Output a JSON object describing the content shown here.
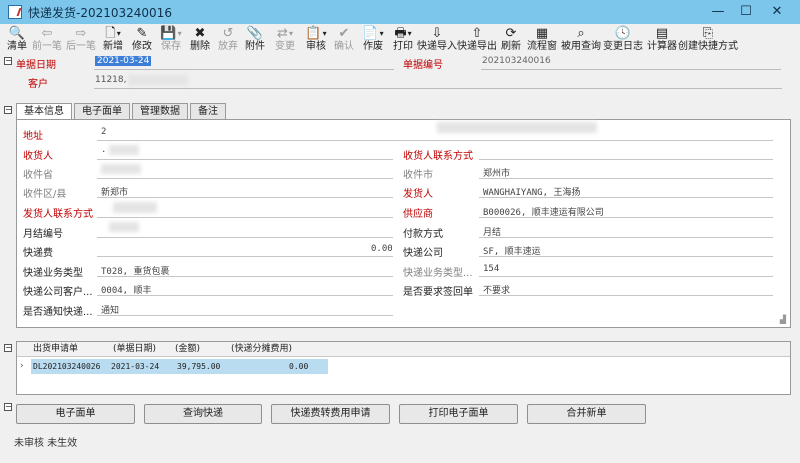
{
  "window": {
    "title": "快递发货-202103240016"
  },
  "toolbar": [
    {
      "label": "清单",
      "icon": "list-search-icon",
      "glyph": "🔍",
      "enabled": true,
      "dd": false
    },
    {
      "label": "前一笔",
      "icon": "arrow-left-icon",
      "glyph": "⇦",
      "enabled": false,
      "dd": false
    },
    {
      "label": "后一笔",
      "icon": "arrow-right-icon",
      "glyph": "⇨",
      "enabled": false,
      "dd": false
    },
    {
      "label": "新增",
      "icon": "new-document-icon",
      "glyph": "🗋",
      "enabled": true,
      "dd": true
    },
    {
      "label": "修改",
      "icon": "edit-icon",
      "glyph": "✎",
      "enabled": true,
      "dd": false
    },
    {
      "label": "保存",
      "icon": "save-icon",
      "glyph": "💾",
      "enabled": false,
      "dd": true
    },
    {
      "label": "删除",
      "icon": "delete-icon",
      "glyph": "✖",
      "enabled": true,
      "dd": false
    },
    {
      "label": "放弃",
      "icon": "discard-icon",
      "glyph": "↺",
      "enabled": false,
      "dd": false
    },
    {
      "label": "附件",
      "icon": "attachment-icon",
      "glyph": "📎",
      "enabled": true,
      "dd": false
    },
    {
      "label": "变更",
      "icon": "change-icon",
      "glyph": "⇄",
      "enabled": false,
      "dd": true
    },
    {
      "label": "审核",
      "icon": "audit-icon",
      "glyph": "📋",
      "enabled": true,
      "dd": true
    },
    {
      "label": "确认",
      "icon": "confirm-icon",
      "glyph": "✔",
      "enabled": false,
      "dd": false
    },
    {
      "label": "作废",
      "icon": "void-icon",
      "glyph": "📄",
      "enabled": true,
      "dd": true
    },
    {
      "label": "打印",
      "icon": "print-icon",
      "glyph": "🖶",
      "enabled": true,
      "dd": true
    },
    {
      "label": "快递导入",
      "icon": "import-icon",
      "glyph": "⇩",
      "enabled": true,
      "dd": false
    },
    {
      "label": "快递导出",
      "icon": "export-icon",
      "glyph": "⇧",
      "enabled": true,
      "dd": false
    },
    {
      "label": "刷新",
      "icon": "refresh-icon",
      "glyph": "⟳",
      "enabled": true,
      "dd": false
    },
    {
      "label": "流程窗",
      "icon": "workflow-icon",
      "glyph": "▦",
      "enabled": true,
      "dd": false
    },
    {
      "label": "被用查询",
      "icon": "reference-query-icon",
      "glyph": "⌕",
      "enabled": true,
      "dd": false
    },
    {
      "label": "变更日志",
      "icon": "change-log-icon",
      "glyph": "🕓",
      "enabled": true,
      "dd": false
    },
    {
      "label": "计算器",
      "icon": "calculator-icon",
      "glyph": "▤",
      "enabled": true,
      "dd": false
    },
    {
      "label": "创建快捷方式",
      "icon": "shortcut-icon",
      "glyph": "⎘",
      "enabled": true,
      "dd": false
    }
  ],
  "header": {
    "date_label": "单据日期",
    "date_value": "2021-03-24",
    "no_label": "单据编号",
    "no_value": "202103240016",
    "customer_label": "客户",
    "customer_value": "11218,"
  },
  "tabs": [
    "基本信息",
    "电子面单",
    "管理数据",
    "备注"
  ],
  "fields": {
    "address_label": "地址",
    "address_value": "2",
    "receiver_label": "收货人",
    "receiver_value": ".",
    "receiver_contact_label": "收货人联系方式",
    "province_label": "收件省",
    "city_label": "收件市",
    "city_value": "郑州市",
    "district_label": "收件区/县",
    "district_value": "新郑市",
    "sender_label": "发货人",
    "sender_value": "WANGHAIYANG, 王海扬",
    "sender_contact_label": "发货人联系方式",
    "supplier_label": "供应商",
    "supplier_value": "B000026, 顺丰速运有限公司",
    "monthly_label": "月结编号",
    "payment_label": "付款方式",
    "payment_value": "月结",
    "fee_label": "快递费",
    "fee_value": "0.00",
    "company_label": "快递公司",
    "company_value": "SF, 顺丰速运",
    "biztype_label": "快递业务类型",
    "biztype_value": "T028, 重货包裹",
    "biztype2_label": "快递业务类型...",
    "biztype2_value": "154",
    "company_cust_label": "快递公司客户...",
    "company_cust_value": "0004, 顺丰",
    "receipt_label": "是否要求签回单",
    "receipt_value": "不要求",
    "notify_label": "是否通知快递...",
    "notify_value": "通知"
  },
  "grid": {
    "headers": [
      "出货申请单",
      "(单据日期)",
      "(金额)",
      "(快递分摊费用)"
    ],
    "rows": [
      [
        "DL202103240026",
        "2021-03-24",
        "39,795.00",
        "0.00"
      ]
    ]
  },
  "buttons": [
    "电子面单",
    "查询快递",
    "快递费转费用申请",
    "打印电子面单",
    "合并新单"
  ],
  "status": "未审核  未生效"
}
